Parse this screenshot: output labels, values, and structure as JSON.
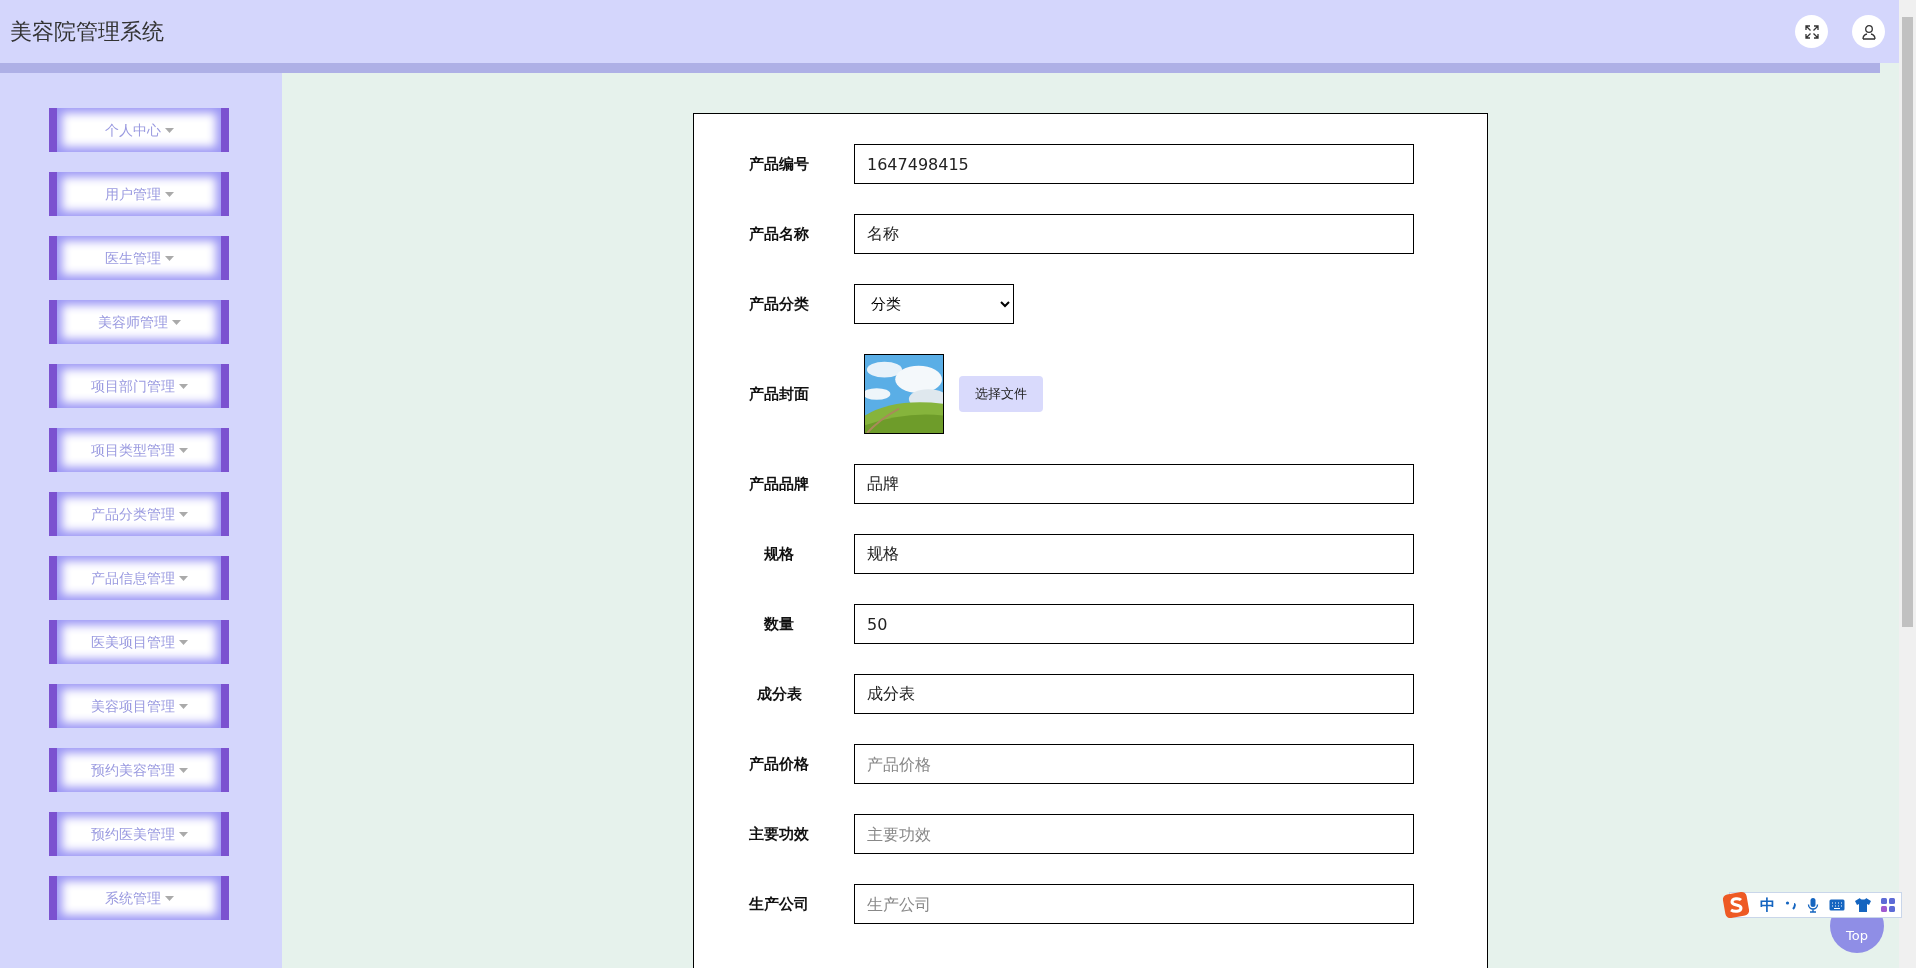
{
  "header": {
    "title": "美容院管理系统"
  },
  "sidebar": {
    "items": [
      {
        "label": "个人中心"
      },
      {
        "label": "用户管理"
      },
      {
        "label": "医生管理"
      },
      {
        "label": "美容师管理"
      },
      {
        "label": "项目部门管理"
      },
      {
        "label": "项目类型管理"
      },
      {
        "label": "产品分类管理"
      },
      {
        "label": "产品信息管理"
      },
      {
        "label": "医美项目管理"
      },
      {
        "label": "美容项目管理"
      },
      {
        "label": "预约美容管理"
      },
      {
        "label": "预约医美管理"
      },
      {
        "label": "系统管理"
      }
    ]
  },
  "form": {
    "fields": [
      {
        "kind": "text",
        "label": "产品编号",
        "value": "1647498415"
      },
      {
        "kind": "text",
        "label": "产品名称",
        "value": "名称"
      },
      {
        "kind": "select",
        "label": "产品分类",
        "value": "分类"
      },
      {
        "label": "产品封面",
        "button": "选择文件"
      },
      {
        "kind": "text",
        "label": "产品品牌",
        "value": "品牌"
      },
      {
        "kind": "text",
        "label": "规格",
        "value": "规格"
      },
      {
        "kind": "text",
        "label": "数量",
        "value": "50"
      },
      {
        "kind": "text",
        "label": "成分表",
        "value": "成分表"
      },
      {
        "kind": "text",
        "label": "产品价格",
        "placeholder": "产品价格"
      },
      {
        "kind": "text",
        "label": "主要功效",
        "placeholder": "主要功效"
      },
      {
        "kind": "text",
        "label": "生产公司",
        "placeholder": "生产公司"
      }
    ]
  },
  "back_to_top": {
    "label": "Top"
  },
  "ime_toolbar": {
    "mode": "中"
  }
}
